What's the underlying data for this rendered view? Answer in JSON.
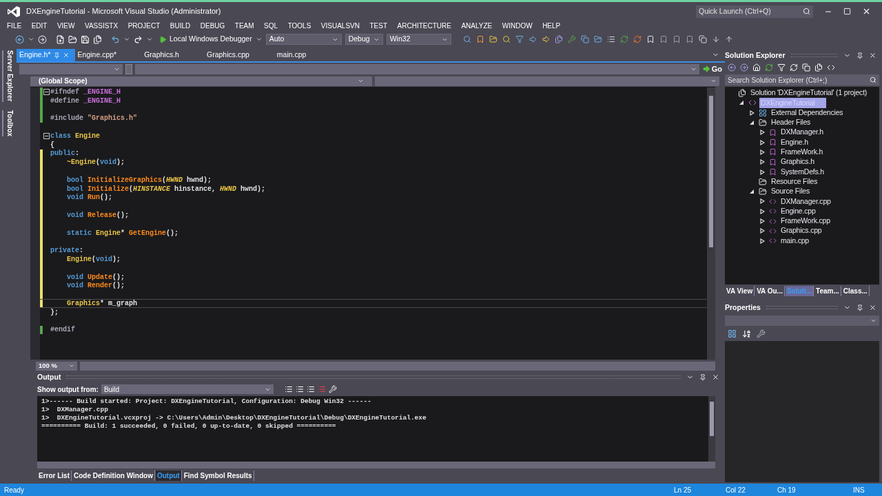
{
  "window": {
    "title": "DXEngineTutorial - Microsoft Visual Studio (Administrator)",
    "quick_launch": {
      "placeholder": "Quick Launch (Ctrl+Q)"
    }
  },
  "menu": [
    "FILE",
    "EDIT",
    "VIEW",
    "VASSISTX",
    "PROJECT",
    "BUILD",
    "DEBUG",
    "TEAM",
    "SQL",
    "TOOLS",
    "VISUALSVN",
    "TEST",
    "ARCHITECTURE",
    "ANALYZE",
    "WINDOW",
    "HELP"
  ],
  "toolbar": {
    "debugger": "Local Windows Debugger",
    "dropdowns": [
      {
        "value": "Auto"
      },
      {
        "value": "Debug"
      },
      {
        "value": "Win32"
      }
    ]
  },
  "side_tabs": [
    "Server Explorer",
    "Toolbox"
  ],
  "editor_tabs": [
    {
      "label": "Engine.h*",
      "selected": true
    },
    {
      "label": "Engine.cpp*",
      "selected": false
    },
    {
      "label": "Graphics.h",
      "selected": false
    },
    {
      "label": "Graphics.cpp",
      "selected": false
    },
    {
      "label": "main.cpp",
      "selected": false
    }
  ],
  "nav": {
    "scope": "(Global Scope)",
    "go": "Go"
  },
  "code_lines": [
    {
      "tokens": [
        {
          "kind": "pre",
          "text": "#ifndef "
        },
        {
          "kind": "macro",
          "text": "_ENGINE_H"
        }
      ],
      "color": "#57a64a",
      "fold": true,
      "current": false,
      "indented": false
    },
    {
      "tokens": [
        {
          "kind": "pre",
          "text": "#define "
        },
        {
          "kind": "macro",
          "text": "_ENGINE_H"
        }
      ],
      "color": "#57a64a",
      "fold": false,
      "current": false,
      "indented": false
    },
    {
      "color": "#57a64a",
      "fold": false,
      "current": false
    },
    {
      "tokens": [
        {
          "kind": "pre",
          "text": "#include "
        },
        {
          "kind": "str",
          "text": "\"Graphics.h\""
        }
      ],
      "color": "#57a64a",
      "fold": false,
      "current": false,
      "indented": false
    },
    {
      "fold": false,
      "current": false
    },
    {
      "tokens": [
        {
          "kind": "kw",
          "text": "class "
        },
        {
          "kind": "cls",
          "text": "Engine"
        }
      ],
      "fold": true,
      "current": false,
      "indented": false
    },
    {
      "tokens": [
        {
          "kind": "txt",
          "text": "{"
        }
      ],
      "fold": false,
      "current": false,
      "indented": false
    },
    {
      "tokens": [
        {
          "kind": "kw",
          "text": "public"
        },
        {
          "kind": "txt",
          "text": ":"
        }
      ],
      "color": "#e8e06a",
      "fold": false,
      "current": false,
      "indented": false
    },
    {
      "tokens": [
        {
          "kind": "cls",
          "text": "~Engine"
        },
        {
          "kind": "txt",
          "text": "("
        },
        {
          "kind": "kw",
          "text": "void"
        },
        {
          "kind": "txt",
          "text": ");"
        }
      ],
      "color": "#e8e06a",
      "fold": false,
      "current": false,
      "indented": true
    },
    {
      "color": "#e8e06a",
      "fold": false,
      "current": false
    },
    {
      "tokens": [
        {
          "kind": "kw",
          "text": "bool "
        },
        {
          "kind": "fn",
          "text": "InitializeGraphics"
        },
        {
          "kind": "txt",
          "text": "("
        },
        {
          "kind": "typ",
          "text": "HWND"
        },
        {
          "kind": "txt",
          "text": " hwnd);"
        }
      ],
      "color": "#e8e06a",
      "fold": false,
      "current": false,
      "indented": true
    },
    {
      "tokens": [
        {
          "kind": "kw",
          "text": "bool "
        },
        {
          "kind": "fn",
          "text": "Initialize"
        },
        {
          "kind": "txt",
          "text": "("
        },
        {
          "kind": "typ",
          "text": "HINSTANCE"
        },
        {
          "kind": "txt",
          "text": " hinstance, "
        },
        {
          "kind": "typ",
          "text": "HWND"
        },
        {
          "kind": "txt",
          "text": " hwnd);"
        }
      ],
      "color": "#e8e06a",
      "fold": false,
      "current": false,
      "indented": true
    },
    {
      "tokens": [
        {
          "kind": "kw",
          "text": "void "
        },
        {
          "kind": "fn",
          "text": "Run"
        },
        {
          "kind": "txt",
          "text": "();"
        }
      ],
      "color": "#e8e06a",
      "fold": false,
      "current": false,
      "indented": true
    },
    {
      "color": "#e8e06a",
      "fold": false,
      "current": false
    },
    {
      "tokens": [
        {
          "kind": "kw",
          "text": "void "
        },
        {
          "kind": "fn",
          "text": "Release"
        },
        {
          "kind": "txt",
          "text": "();"
        }
      ],
      "color": "#e8e06a",
      "fold": false,
      "current": false,
      "indented": true
    },
    {
      "color": "#e8e06a",
      "fold": false,
      "current": false
    },
    {
      "tokens": [
        {
          "kind": "kw",
          "text": "static "
        },
        {
          "kind": "cls",
          "text": "Engine"
        },
        {
          "kind": "txt",
          "text": "* "
        },
        {
          "kind": "fn",
          "text": "GetEngine"
        },
        {
          "kind": "txt",
          "text": "();"
        }
      ],
      "color": "#e8e06a",
      "fold": false,
      "current": false,
      "indented": true
    },
    {
      "color": "#e8e06a",
      "fold": false,
      "current": false
    },
    {
      "tokens": [
        {
          "kind": "kw",
          "text": "private"
        },
        {
          "kind": "txt",
          "text": ":"
        }
      ],
      "color": "#e8e06a",
      "fold": false,
      "current": false,
      "indented": false
    },
    {
      "tokens": [
        {
          "kind": "cls",
          "text": "Engine"
        },
        {
          "kind": "txt",
          "text": "("
        },
        {
          "kind": "kw",
          "text": "void"
        },
        {
          "kind": "txt",
          "text": ");"
        }
      ],
      "color": "#e8e06a",
      "fold": false,
      "current": false,
      "indented": true
    },
    {
      "color": "#e8e06a",
      "fold": false,
      "current": false
    },
    {
      "tokens": [
        {
          "kind": "kw",
          "text": "void "
        },
        {
          "kind": "fn",
          "text": "Update"
        },
        {
          "kind": "txt",
          "text": "();"
        }
      ],
      "color": "#e8e06a",
      "fold": false,
      "current": false,
      "indented": true
    },
    {
      "tokens": [
        {
          "kind": "kw",
          "text": "void "
        },
        {
          "kind": "fn",
          "text": "Render"
        },
        {
          "kind": "txt",
          "text": "();"
        }
      ],
      "color": "#e8e06a",
      "fold": false,
      "current": false,
      "indented": true
    },
    {
      "color": "#e8e06a",
      "fold": false,
      "current": false
    },
    {
      "tokens": [
        {
          "kind": "cls",
          "text": "Graphics"
        },
        {
          "kind": "txt",
          "text": "* m_graph"
        }
      ],
      "color": "#e8e06a",
      "fold": false,
      "current": true,
      "indented": true
    },
    {
      "tokens": [
        {
          "kind": "txt",
          "text": "};"
        }
      ],
      "fold": false,
      "current": false,
      "indented": false
    },
    {
      "fold": false,
      "current": false
    },
    {
      "tokens": [
        {
          "kind": "pre",
          "text": "#endif"
        }
      ],
      "color": "#57a64a",
      "fold": false,
      "current": false,
      "indented": false
    }
  ],
  "zoom": "100 %",
  "output": {
    "title": "Output",
    "show_from_label": "Show output from:",
    "source": "Build",
    "lines": [
      "1>------ Build started: Project: DXEngineTutorial, Configuration: Debug Win32 ------",
      "1>  DXManager.cpp",
      "1>  DXEngineTutorial.vcxproj -> C:\\Users\\Admin\\Desktop\\DXEngineTutorial\\Debug\\DXEngineTutorial.exe",
      "========== Build: 1 succeeded, 0 failed, 0 up-to-date, 0 skipped =========="
    ]
  },
  "bottom_tabs": [
    {
      "label": "Error List",
      "selected": false
    },
    {
      "label": "Code Definition Window",
      "selected": false
    },
    {
      "label": "Output",
      "selected": true
    },
    {
      "label": "Find Symbol Results",
      "selected": false
    }
  ],
  "solution_explorer": {
    "title": "Solution Explorer",
    "search": {
      "placeholder": "Search Solution Explorer (Ctrl+;)"
    },
    "tree": [
      {
        "label": "Solution 'DXEngineTutorial' (1 project)",
        "kind": "solution",
        "selected": false,
        "children": [
          {
            "label": "DXEngineTutorial",
            "kind": "project",
            "selected": true,
            "expanded": true,
            "children": [
              {
                "label": "External Dependencies",
                "kind": "deps",
                "selected": false,
                "expanded": false
              },
              {
                "label": "Header Files",
                "kind": "folder",
                "selected": false,
                "expanded": true,
                "children": [
                  {
                    "label": "DXManager.h",
                    "kind": "header",
                    "selected": false,
                    "expanded": false
                  },
                  {
                    "label": "Engine.h",
                    "kind": "header",
                    "selected": false,
                    "expanded": false
                  },
                  {
                    "label": "FrameWork.h",
                    "kind": "header",
                    "selected": false,
                    "expanded": false
                  },
                  {
                    "label": "Graphics.h",
                    "kind": "header",
                    "selected": false,
                    "expanded": false
                  },
                  {
                    "label": "SystemDefs.h",
                    "kind": "header",
                    "selected": false,
                    "expanded": false
                  }
                ]
              },
              {
                "label": "Resource Files",
                "kind": "folder",
                "selected": false
              },
              {
                "label": "Source Files",
                "kind": "folder",
                "selected": false,
                "expanded": true,
                "children": [
                  {
                    "label": "DXManager.cpp",
                    "kind": "source",
                    "selected": false,
                    "expanded": false
                  },
                  {
                    "label": "Engine.cpp",
                    "kind": "source",
                    "selected": false,
                    "expanded": false
                  },
                  {
                    "label": "FrameWork.cpp",
                    "kind": "source",
                    "selected": false,
                    "expanded": false
                  },
                  {
                    "label": "Graphics.cpp",
                    "kind": "source",
                    "selected": false,
                    "expanded": false
                  },
                  {
                    "label": "main.cpp",
                    "kind": "source",
                    "selected": false,
                    "expanded": false
                  }
                ]
              }
            ]
          }
        ]
      }
    ]
  },
  "panel_tabs": [
    {
      "label": "VA View",
      "selected": false
    },
    {
      "label": "VA Ou...",
      "selected": false
    },
    {
      "label": "Soluti...",
      "selected": true
    },
    {
      "label": "Team...",
      "selected": false
    },
    {
      "label": "Class...",
      "selected": false
    }
  ],
  "properties": {
    "title": "Properties"
  },
  "status": {
    "message": "Ready",
    "ln": "Ln 25",
    "col": "Col 22",
    "ch": "Ch 19",
    "mode": "INS"
  }
}
